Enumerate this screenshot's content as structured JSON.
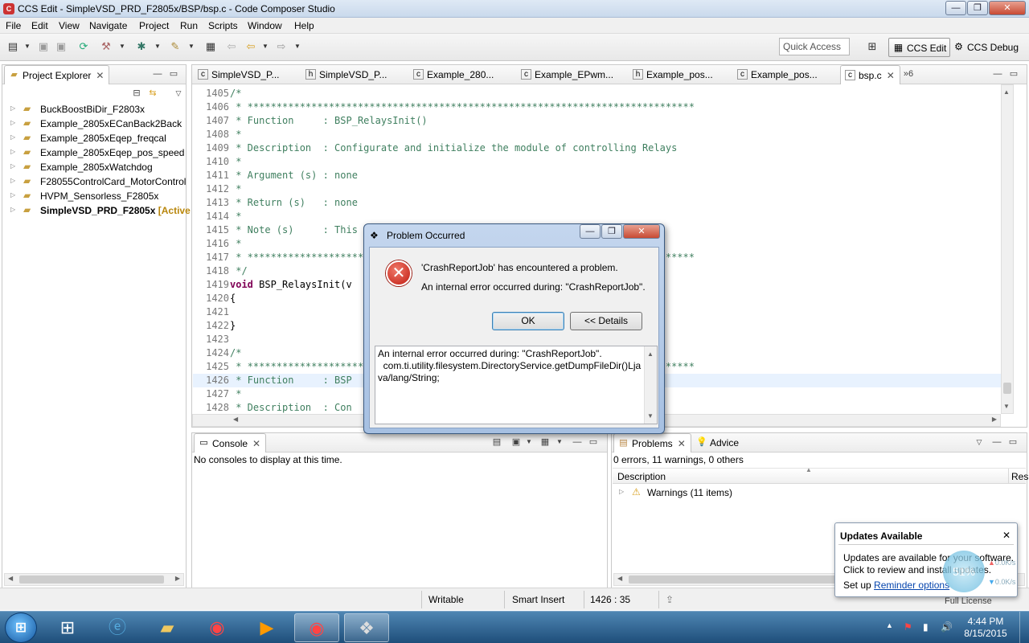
{
  "window": {
    "title": "CCS Edit - SimpleVSD_PRD_F2805x/BSP/bsp.c - Code Composer Studio",
    "app_icon": "ccs-icon"
  },
  "menu": [
    "File",
    "Edit",
    "View",
    "Navigate",
    "Project",
    "Run",
    "Scripts",
    "Window",
    "Help"
  ],
  "toolbar": {
    "quick_access": "Quick Access",
    "perspectives": [
      {
        "label": "CCS Edit",
        "active": true
      },
      {
        "label": "CCS Debug",
        "active": false
      }
    ]
  },
  "explorer": {
    "title": "Project Explorer",
    "projects": [
      {
        "name": "BuckBoostBiDir_F2803x",
        "active": false
      },
      {
        "name": "Example_2805xECanBack2Back",
        "active": false
      },
      {
        "name": "Example_2805xEqep_freqcal",
        "active": false
      },
      {
        "name": "Example_2805xEqep_pos_speed",
        "active": false
      },
      {
        "name": "Example_2805xWatchdog",
        "active": false
      },
      {
        "name": "F28055ControlCard_MotorControl",
        "active": false
      },
      {
        "name": "HVPM_Sensorless_F2805x",
        "active": false
      },
      {
        "name": "SimpleVSD_PRD_F2805x",
        "active": true,
        "tag": "[Active"
      }
    ]
  },
  "editor": {
    "tabs": [
      {
        "label": "SimpleVSD_P...",
        "icon": "c-file-icon"
      },
      {
        "label": "SimpleVSD_P...",
        "icon": "h-file-icon"
      },
      {
        "label": "Example_280...",
        "icon": "c-file-icon"
      },
      {
        "label": "Example_EPwm...",
        "icon": "c-file-icon"
      },
      {
        "label": "Example_pos...",
        "icon": "h-file-icon"
      },
      {
        "label": "Example_pos...",
        "icon": "c-file-icon"
      },
      {
        "label": "bsp.c",
        "icon": "c-file-icon",
        "selected": true
      }
    ],
    "overflow": "»6",
    "lines": [
      {
        "n": "1405",
        "text": "/*"
      },
      {
        "n": "1406",
        "text": " * *****************************************************************************"
      },
      {
        "n": "1407",
        "text": " * Function     : BSP_RelaysInit()"
      },
      {
        "n": "1408",
        "text": " *"
      },
      {
        "n": "1409",
        "text": " * Description  : Configurate and initialize the module of controlling Relays"
      },
      {
        "n": "1410",
        "text": " *"
      },
      {
        "n": "1411",
        "text": " * Argument (s) : none"
      },
      {
        "n": "1412",
        "text": " *"
      },
      {
        "n": "1413",
        "text": " * Return (s)   : none"
      },
      {
        "n": "1414",
        "text": " *"
      },
      {
        "n": "1415",
        "text": " * Note (s)     : This                                     initialization"
      },
      {
        "n": "1416",
        "text": " *"
      },
      {
        "n": "1417",
        "text": " * *****************************************************************************"
      },
      {
        "n": "1418",
        "text": " */"
      },
      {
        "n": "1419",
        "text": "void BSP_RelaysInit(v",
        "kind": "code"
      },
      {
        "n": "1420",
        "text": "{",
        "kind": "code"
      },
      {
        "n": "1421",
        "text": "",
        "kind": "code"
      },
      {
        "n": "1422",
        "text": "}",
        "kind": "code"
      },
      {
        "n": "1423",
        "text": "",
        "kind": "code"
      },
      {
        "n": "1424",
        "text": "/*"
      },
      {
        "n": "1425",
        "text": " * *****************************************************************************"
      },
      {
        "n": "1426",
        "text": " * Function     : BSP                                      ",
        "highlight": true
      },
      {
        "n": "1427",
        "text": " *"
      },
      {
        "n": "1428",
        "text": " * Description  : Con                                      ng Relays"
      }
    ]
  },
  "dialog": {
    "title": "Problem Occurred",
    "message1": "'CrashReportJob' has encountered a problem.",
    "message2": "An internal error occurred during: \"CrashReportJob\".",
    "ok": "OK",
    "details": "<< Details",
    "details_text": [
      "An internal error occurred during: \"CrashReportJob\".",
      "  com.ti.utility.filesystem.DirectoryService.getDumpFileDir()Lja",
      "va/lang/String;"
    ]
  },
  "console": {
    "title": "Console",
    "message": "No consoles to display at this time."
  },
  "problems": {
    "tabs": [
      "Problems",
      "Advice"
    ],
    "summary": "0 errors, 11 warnings, 0 others",
    "columns": [
      "Description",
      "Res"
    ],
    "rows": [
      "Warnings (11 items)"
    ]
  },
  "status": {
    "mode": "Writable",
    "insert": "Smart Insert",
    "position": "1426 : 35",
    "license": "Full License"
  },
  "notification": {
    "title": "Updates Available",
    "line1": "Updates are available for your software.",
    "line2": "Click to review and install updates.",
    "setup": "Set up",
    "link": "Reminder options"
  },
  "netmeter": {
    "percent": "51%",
    "up": "0.0K/s",
    "down": "0.0K/s"
  },
  "taskbar": {
    "time": "4:44 PM",
    "date": "8/15/2015"
  }
}
